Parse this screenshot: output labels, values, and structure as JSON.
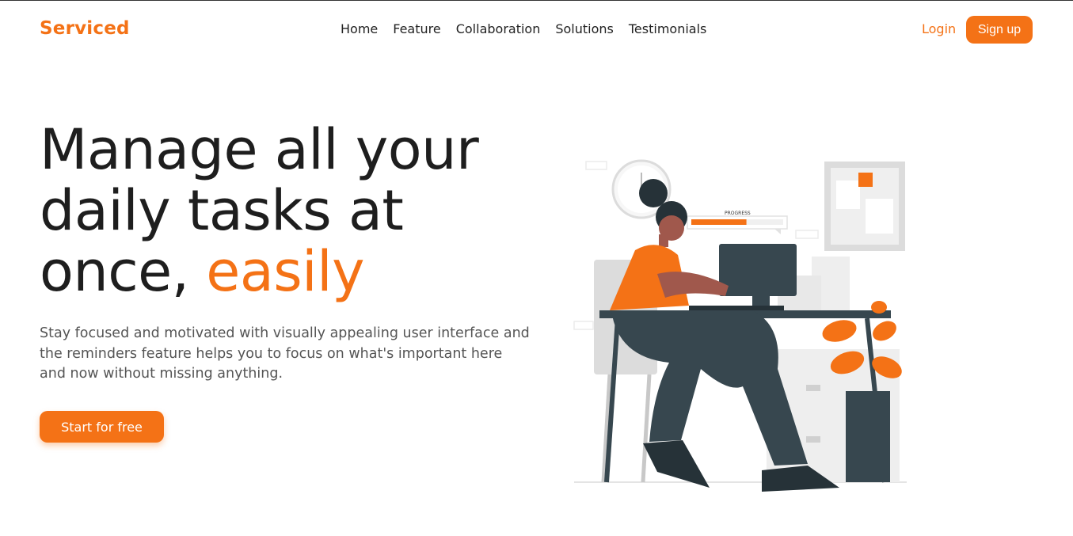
{
  "brand": {
    "name": "Serviced",
    "color": "#f47216"
  },
  "nav": {
    "items": [
      "Home",
      "Feature",
      "Collaboration",
      "Solutions",
      "Testimonials"
    ],
    "login_label": "Login",
    "signup_label": "Sign up"
  },
  "hero": {
    "title_part1": "Manage all your daily tasks at once, ",
    "title_accent": "easily",
    "subtitle": "Stay focused and motivated with visually appealing user interface and the reminders feature helps you to focus on what's important here and now without missing anything.",
    "cta_label": "Start for free"
  },
  "illustration": {
    "progress_label": "PROGRESS",
    "progress_percent": 60
  }
}
